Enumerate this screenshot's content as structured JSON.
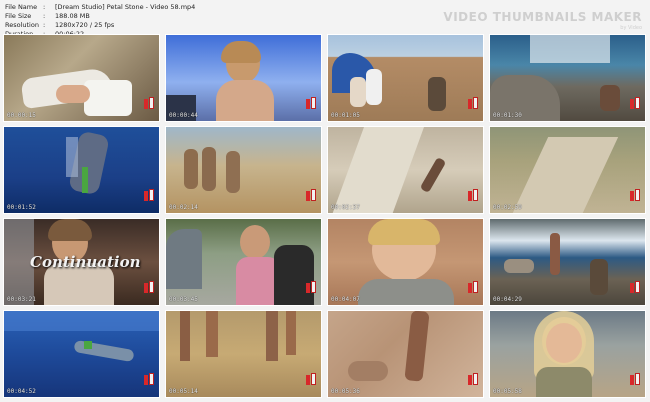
{
  "header": {
    "file_name_label": "File Name",
    "file_name": "[Dream Studio] Petal Stone - Video 58.mp4",
    "file_size_label": "File Size",
    "file_size": "188.08 MB",
    "resolution_label": "Resolution",
    "resolution": "1280x720 / 25 fps",
    "duration_label": "Duration",
    "duration": "00:06:22",
    "separator": ":"
  },
  "brand": {
    "title": "VIDEO THUMBNAILS MAKER",
    "subtitle": "by Video"
  },
  "thumbnails": [
    {
      "timestamp": "00:00:15",
      "overlay": ""
    },
    {
      "timestamp": "00:00:44",
      "overlay": ""
    },
    {
      "timestamp": "00:01:05",
      "overlay": ""
    },
    {
      "timestamp": "00:01:30",
      "overlay": ""
    },
    {
      "timestamp": "00:01:52",
      "overlay": ""
    },
    {
      "timestamp": "00:02:14",
      "overlay": ""
    },
    {
      "timestamp": "00:02:37",
      "overlay": ""
    },
    {
      "timestamp": "00:02:59",
      "overlay": ""
    },
    {
      "timestamp": "00:03:21",
      "overlay": "Continuation"
    },
    {
      "timestamp": "00:03:45",
      "overlay": ""
    },
    {
      "timestamp": "00:04:07",
      "overlay": ""
    },
    {
      "timestamp": "00:04:29",
      "overlay": ""
    },
    {
      "timestamp": "00:04:52",
      "overlay": ""
    },
    {
      "timestamp": "00:05:14",
      "overlay": ""
    },
    {
      "timestamp": "00:05:36",
      "overlay": ""
    },
    {
      "timestamp": "00:05:58",
      "overlay": ""
    }
  ]
}
